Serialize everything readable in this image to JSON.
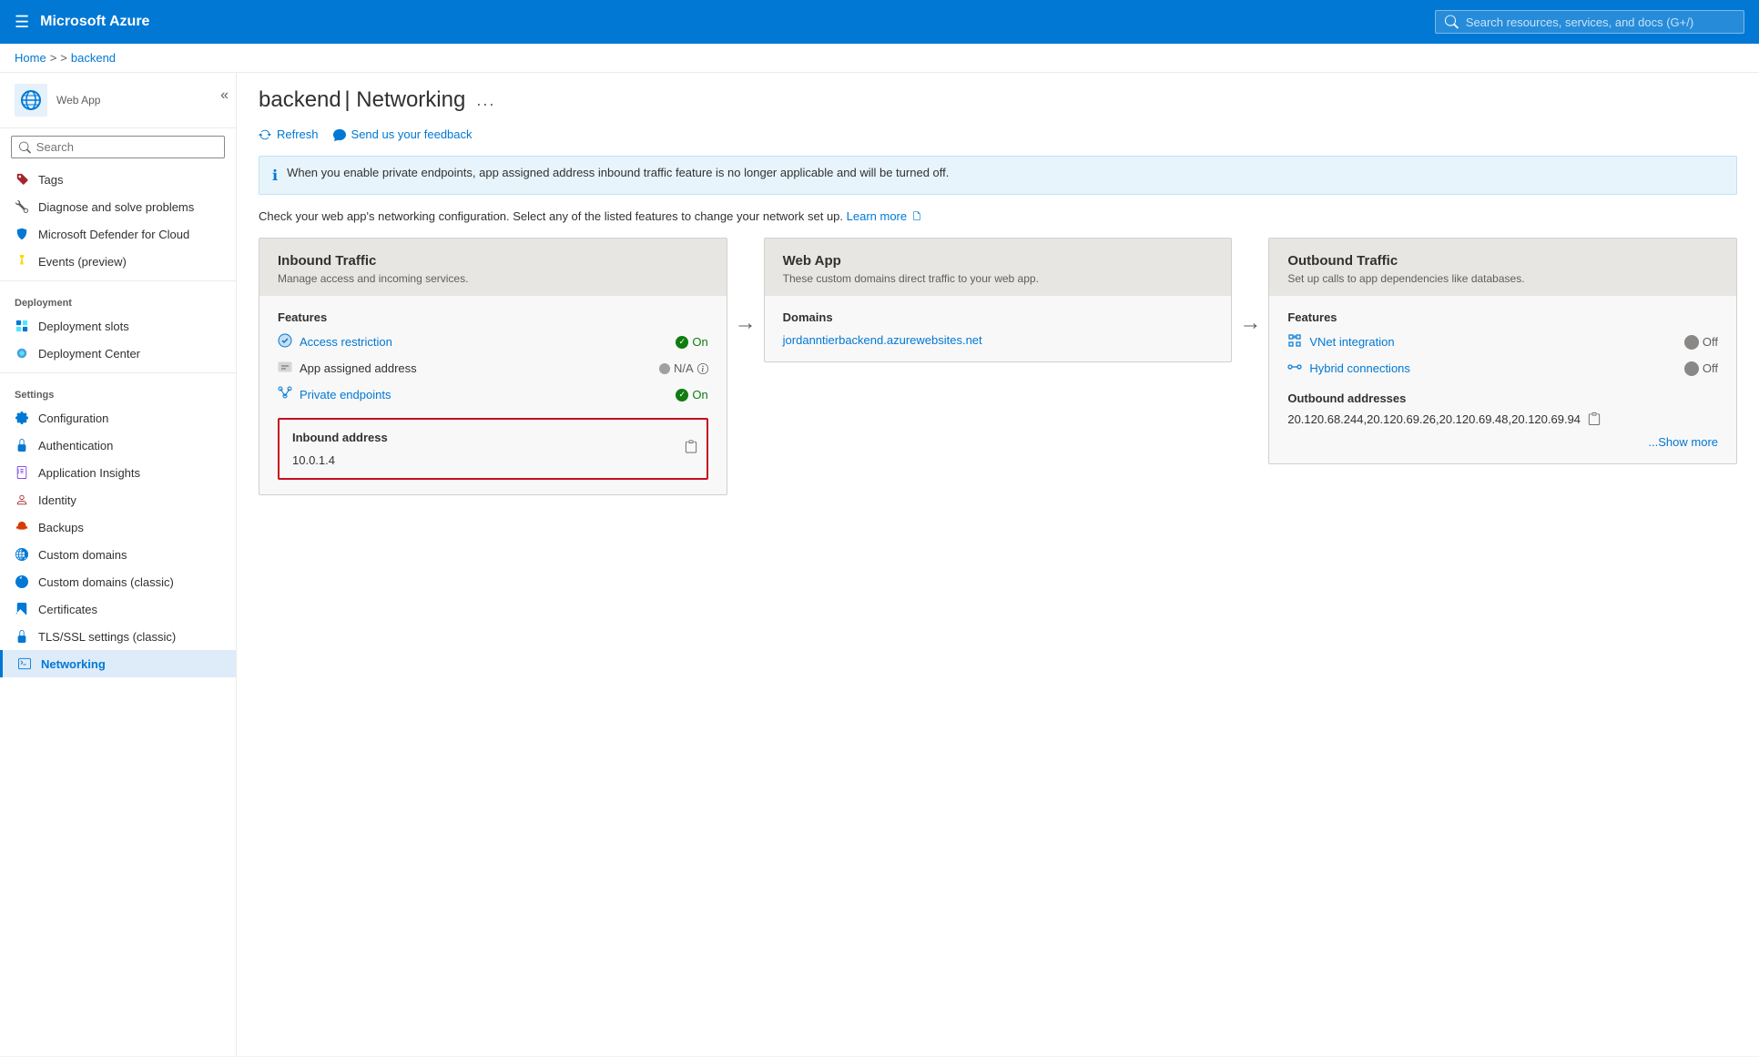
{
  "topBar": {
    "hamburger": "☰",
    "title": "Microsoft Azure",
    "searchPlaceholder": "Search resources, services, and docs (G+/)"
  },
  "breadcrumb": {
    "home": "Home",
    "sep1": ">",
    "sep2": ">",
    "current": "backend"
  },
  "pageHeader": {
    "appIcon": "🌐",
    "appLabel": "Web App",
    "title": "backend",
    "separator": "|",
    "subtitle": "Networking",
    "more": "..."
  },
  "toolbar": {
    "refresh": "Refresh",
    "feedback": "Send us your feedback"
  },
  "infoBanner": {
    "text": "When you enable private endpoints, app assigned address inbound traffic feature is no longer applicable and will be turned off."
  },
  "description": {
    "text": "Check your web app's networking configuration. Select any of the listed features to change your network set up.",
    "learnMore": "Learn more"
  },
  "sidebar": {
    "searchPlaceholder": "Search",
    "items": [
      {
        "id": "tags",
        "label": "Tags",
        "icon": "tag"
      },
      {
        "id": "diagnose",
        "label": "Diagnose and solve problems",
        "icon": "wrench"
      },
      {
        "id": "defender",
        "label": "Microsoft Defender for Cloud",
        "icon": "shield"
      },
      {
        "id": "events",
        "label": "Events (preview)",
        "icon": "lightning"
      }
    ],
    "sections": [
      {
        "label": "Deployment",
        "items": [
          {
            "id": "deployment-slots",
            "label": "Deployment slots",
            "icon": "slots"
          },
          {
            "id": "deployment-center",
            "label": "Deployment Center",
            "icon": "center"
          }
        ]
      },
      {
        "label": "Settings",
        "items": [
          {
            "id": "configuration",
            "label": "Configuration",
            "icon": "config"
          },
          {
            "id": "authentication",
            "label": "Authentication",
            "icon": "auth"
          },
          {
            "id": "app-insights",
            "label": "Application Insights",
            "icon": "insights"
          },
          {
            "id": "identity",
            "label": "Identity",
            "icon": "identity"
          },
          {
            "id": "backups",
            "label": "Backups",
            "icon": "backups"
          },
          {
            "id": "custom-domains",
            "label": "Custom domains",
            "icon": "domains"
          },
          {
            "id": "custom-domains-classic",
            "label": "Custom domains (classic)",
            "icon": "domains-classic"
          },
          {
            "id": "certificates",
            "label": "Certificates",
            "icon": "cert"
          },
          {
            "id": "tls-ssl",
            "label": "TLS/SSL settings (classic)",
            "icon": "tls"
          },
          {
            "id": "networking",
            "label": "Networking",
            "icon": "network",
            "active": true
          }
        ]
      }
    ]
  },
  "inboundTraffic": {
    "title": "Inbound Traffic",
    "subtitle": "Manage access and incoming services.",
    "featuresLabel": "Features",
    "features": [
      {
        "name": "Access restriction",
        "status": "On",
        "statusType": "on"
      },
      {
        "name": "App assigned address",
        "status": "N/A",
        "statusType": "na"
      },
      {
        "name": "Private endpoints",
        "status": "On",
        "statusType": "on"
      }
    ],
    "inboundAddressLabel": "Inbound address",
    "inboundAddress": "10.0.1.4"
  },
  "webApp": {
    "title": "Web App",
    "subtitle": "These custom domains direct traffic to your web app.",
    "domainsLabel": "Domains",
    "domain": "jordanntierbackend.azurewebsites.net"
  },
  "outboundTraffic": {
    "title": "Outbound Traffic",
    "subtitle": "Set up calls to app dependencies like databases.",
    "featuresLabel": "Features",
    "features": [
      {
        "name": "VNet integration",
        "status": "Off",
        "statusType": "off"
      },
      {
        "name": "Hybrid connections",
        "status": "Off",
        "statusType": "off"
      }
    ],
    "outboundAddressesLabel": "Outbound addresses",
    "outboundAddresses": "20.120.68.244,20.120.69.26,20.120.69.48,20.120.69.94",
    "showMore": "...Show more"
  }
}
